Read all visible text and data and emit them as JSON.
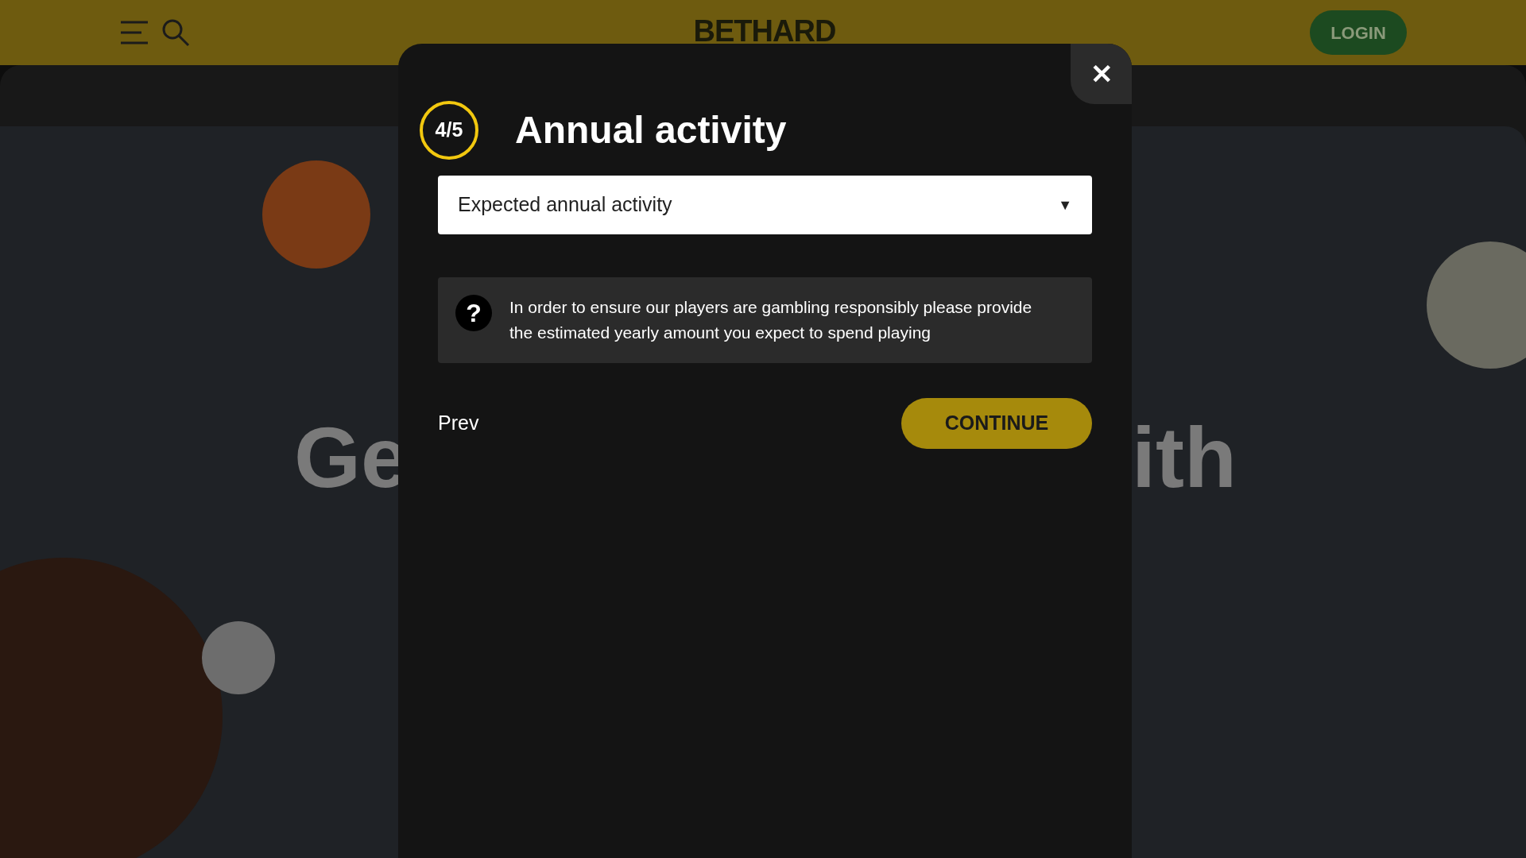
{
  "header": {
    "logo": "BETHARD",
    "login": "LOGIN"
  },
  "hero": {
    "heading_left": "Ge",
    "heading_right": "ith"
  },
  "modal": {
    "step": {
      "label": "4/5"
    },
    "title": "Annual activity",
    "close": "✕",
    "select": {
      "placeholder": "Expected annual activity",
      "caret": "▼"
    },
    "info": {
      "icon": "?",
      "text": "In order to ensure our players are gambling responsibly please provide the estimated yearly amount you expect to spend playing"
    },
    "prev": "Prev",
    "continue": "CONTINUE"
  }
}
